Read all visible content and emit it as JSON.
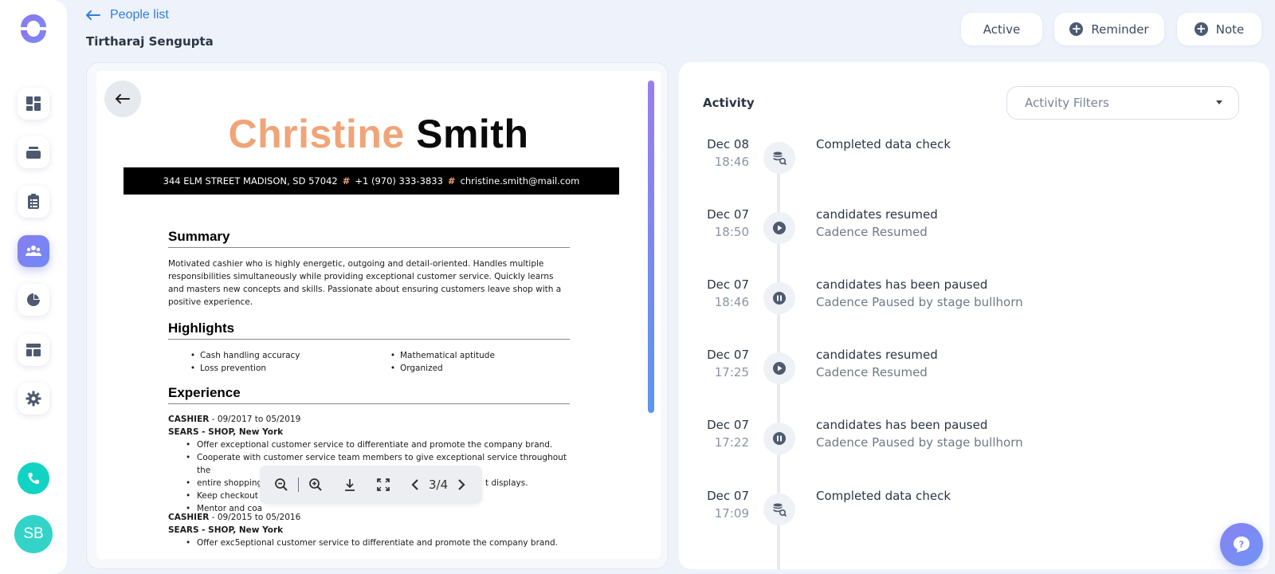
{
  "header": {
    "back_label": "People list",
    "page_title": "Tirtharaj Sengupta",
    "status_label": "Active",
    "reminder_label": "Reminder",
    "note_label": "Note"
  },
  "sidebar": {
    "items": [
      {
        "icon": "dashboard-icon"
      },
      {
        "icon": "stack-icon"
      },
      {
        "icon": "clipboard-icon"
      },
      {
        "icon": "people-icon",
        "active": true
      },
      {
        "icon": "pie-chart-icon"
      },
      {
        "icon": "layout-icon"
      },
      {
        "icon": "gear-icon"
      }
    ],
    "avatar_initials": "SB"
  },
  "resume": {
    "first_name": "Christine",
    "last_name": "Smith",
    "address": "344 ELM STREET MADISON, SD 57042",
    "phone": "+1 (970) 333-3833",
    "email": "christine.smith@mail.com",
    "separator": "#",
    "summary_title": "Summary",
    "summary_text": "Motivated cashier who is highly energetic, outgoing and detail-oriented. Handles multiple responsibilities simultaneously while providing exceptional customer service. Quickly learns and masters new concepts and skills. Passionate about ensuring customers leave shop with a positive experience.",
    "highlights_title": "Highlights",
    "highlights_left": [
      "Cash handling accuracy",
      "Loss prevention"
    ],
    "highlights_right": [
      "Mathematical aptitude",
      "Organized"
    ],
    "experience_title": "Experience",
    "job1_role": "CASHIER",
    "job1_dates": " - 09/2017 to 05/2019",
    "job1_company": "SEARS - SHOP, New York",
    "job1_bullets": [
      "Offer exceptional customer service to differentiate and promote the company brand.",
      "Cooperate with customer service team members to give exceptional service throughout the",
      "entire shopping",
      "Keep checkout l",
      "Mentor and coa"
    ],
    "job1_bullet3_tail": "t displays.",
    "job2_role": "CASHIER",
    "job2_dates": " - 09/2015 to 05/2016",
    "job2_company": "SEARS - SHOP, New York",
    "job2_bullets": [
      "Offer exc5eptional customer service to differentiate and promote the company brand."
    ]
  },
  "viewer": {
    "page_indicator": "3/4"
  },
  "activity": {
    "title": "Activity",
    "filter_placeholder": "Activity Filters",
    "entries": [
      {
        "date": "Dec 08",
        "time": "18:46",
        "title": "Completed data check",
        "sub": "",
        "icon": "data-check-icon"
      },
      {
        "date": "Dec 07",
        "time": "18:50",
        "title": "candidates resumed",
        "sub": "Cadence Resumed",
        "icon": "play-icon"
      },
      {
        "date": "Dec 07",
        "time": "18:46",
        "title": "candidates has been paused",
        "sub": "Cadence Paused by stage bullhorn",
        "icon": "pause-icon"
      },
      {
        "date": "Dec 07",
        "time": "17:25",
        "title": "candidates resumed",
        "sub": "Cadence Resumed",
        "icon": "play-icon"
      },
      {
        "date": "Dec 07",
        "time": "17:22",
        "title": "candidates has been paused",
        "sub": "Cadence Paused by stage bullhorn",
        "icon": "pause-icon"
      },
      {
        "date": "Dec 07",
        "time": "17:09",
        "title": "Completed data check",
        "sub": "",
        "icon": "data-check-icon"
      }
    ]
  },
  "colors": {
    "accent": "#2e7de3",
    "active_nav": "#7d84f2",
    "phone": "#11d3c4",
    "resume_first_name": "#f0a478"
  }
}
